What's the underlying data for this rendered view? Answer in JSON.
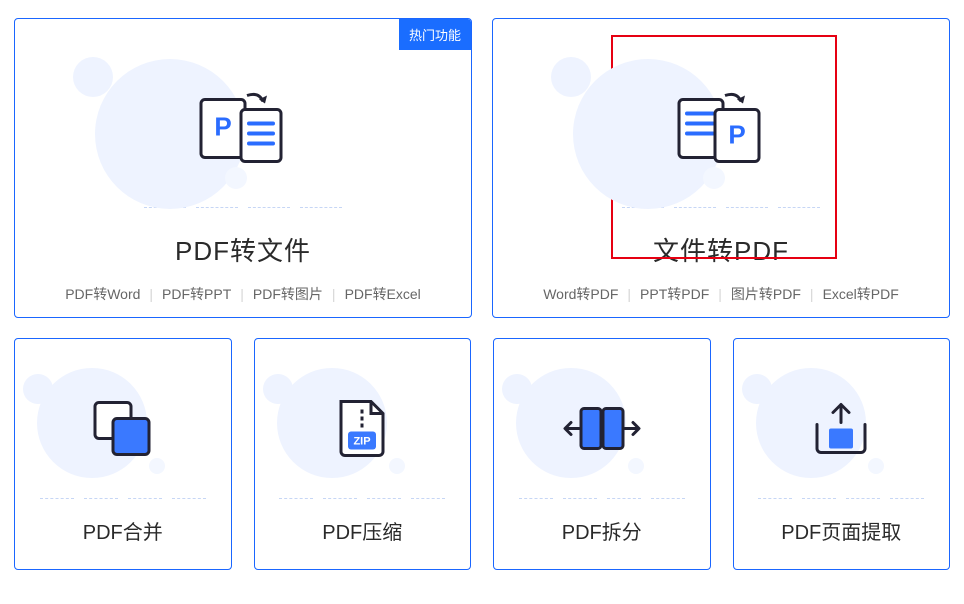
{
  "badge": "热门功能",
  "cards": {
    "pdf_to_file": {
      "title": "PDF转文件",
      "tags": [
        "PDF转Word",
        "PDF转PPT",
        "PDF转图片",
        "PDF转Excel"
      ]
    },
    "file_to_pdf": {
      "title": "文件转PDF",
      "tags": [
        "Word转PDF",
        "PPT转PDF",
        "图片转PDF",
        "Excel转PDF"
      ]
    },
    "merge": {
      "title": "PDF合并"
    },
    "compress": {
      "title": "PDF压缩",
      "zip_label": "ZIP"
    },
    "split": {
      "title": "PDF拆分"
    },
    "extract": {
      "title": "PDF页面提取"
    }
  }
}
